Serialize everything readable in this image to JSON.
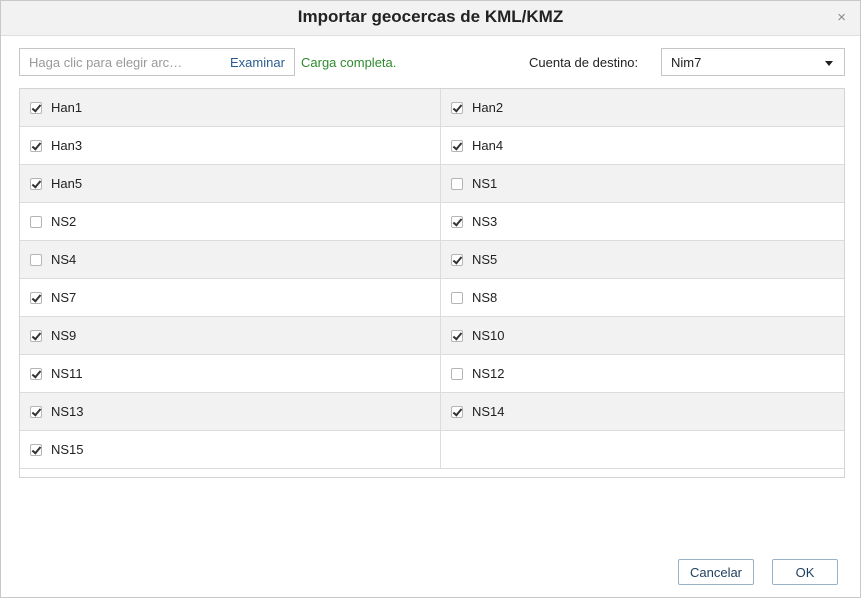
{
  "dialog": {
    "title": "Importar geocercas de KML/KMZ",
    "close_glyph": "×"
  },
  "toolbar": {
    "file_placeholder": "Haga clic para elegir arc…",
    "browse_label": "Examinar",
    "status_text": "Carga completa.",
    "status_color": "#2e8b2e",
    "account_label": "Cuenta de destino:",
    "account_value": "Nim7"
  },
  "geofences": [
    {
      "label": "Han1",
      "checked": true
    },
    {
      "label": "Han2",
      "checked": true
    },
    {
      "label": "Han3",
      "checked": true
    },
    {
      "label": "Han4",
      "checked": true
    },
    {
      "label": "Han5",
      "checked": true
    },
    {
      "label": "NS1",
      "checked": false
    },
    {
      "label": "NS2",
      "checked": false
    },
    {
      "label": "NS3",
      "checked": true
    },
    {
      "label": "NS4",
      "checked": false
    },
    {
      "label": "NS5",
      "checked": true
    },
    {
      "label": "NS7",
      "checked": true
    },
    {
      "label": "NS8",
      "checked": false
    },
    {
      "label": "NS9",
      "checked": true
    },
    {
      "label": "NS10",
      "checked": true
    },
    {
      "label": "NS11",
      "checked": true
    },
    {
      "label": "NS12",
      "checked": false
    },
    {
      "label": "NS13",
      "checked": true
    },
    {
      "label": "NS14",
      "checked": true
    },
    {
      "label": "NS15",
      "checked": true
    }
  ],
  "buttons": {
    "cancel_label": "Cancelar",
    "ok_label": "OK"
  }
}
